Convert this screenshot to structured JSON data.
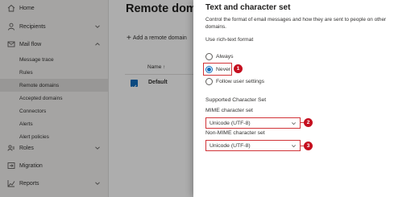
{
  "nav": {
    "items": [
      {
        "label": "Home",
        "icon": "home-icon"
      },
      {
        "label": "Recipients",
        "icon": "person-icon"
      },
      {
        "label": "Mail flow",
        "icon": "mail-flow-icon"
      }
    ],
    "mail_flow_sub": [
      "Message trace",
      "Rules",
      "Remote domains",
      "Accepted domains",
      "Connectors",
      "Alerts",
      "Alert policies"
    ],
    "bottom_items": [
      {
        "label": "Roles",
        "icon": "roles-icon"
      },
      {
        "label": "Migration",
        "icon": "migration-icon"
      },
      {
        "label": "Reports",
        "icon": "reports-icon"
      }
    ]
  },
  "main": {
    "title": "Remote doma",
    "add_label": "Add a remote domain",
    "column_name": "Name ↑",
    "row_name": "Default"
  },
  "panel": {
    "title": "Text and character set",
    "description": "Control the format of email messages and how they are sent to people on other domains.",
    "rich_text_label": "Use rich-text format",
    "options": [
      "Always",
      "Never",
      "Follow user settings"
    ],
    "selected_option": "Never",
    "charset_section": "Supported Character Set",
    "mime_label": "MIME character set",
    "mime_value": "Unicode (UTF-8)",
    "non_mime_label": "Non-MIME character set",
    "non_mime_value": "Unicode (UTF-8)"
  },
  "callouts": [
    "1",
    "2",
    "3"
  ],
  "colors": {
    "accent": "#0f6cbd",
    "callout": "#c50f1f",
    "highlight": "#d13438"
  }
}
